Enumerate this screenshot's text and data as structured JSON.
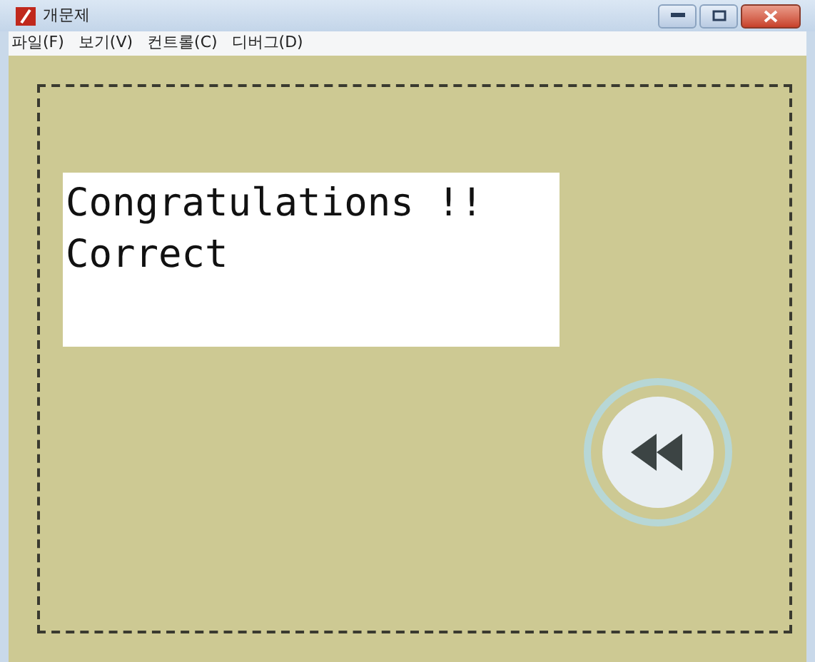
{
  "window": {
    "title": "개문제"
  },
  "menu": [
    {
      "label": "파일(F)"
    },
    {
      "label": "보기(V)"
    },
    {
      "label": "컨트롤(C)"
    },
    {
      "label": "디버그(D)"
    }
  ],
  "message": {
    "lines": [
      "Congratulations !!",
      "Correct"
    ]
  }
}
